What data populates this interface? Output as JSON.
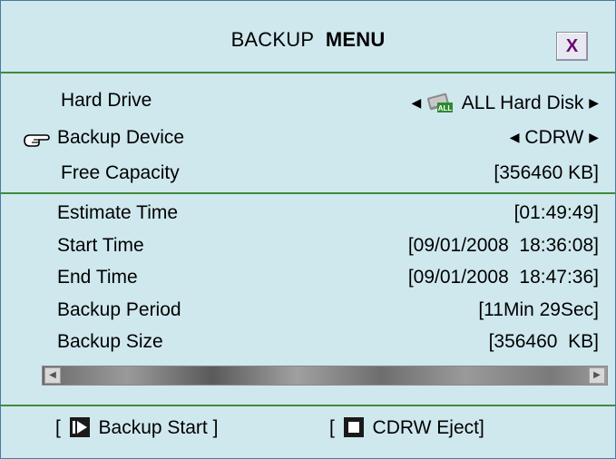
{
  "title": {
    "normal": "BACKUP",
    "bold": "MENU"
  },
  "close_button": {
    "label": "X"
  },
  "settings": {
    "hard_drive": {
      "label": "Hard Drive",
      "value": "ALL Hard Disk",
      "icon_label": "ALL"
    },
    "backup_device": {
      "label": "Backup Device",
      "value": "CDRW"
    },
    "free_capacity": {
      "label": "Free Capacity",
      "value": "[356460 KB]"
    }
  },
  "status": {
    "estimate_time": {
      "label": "Estimate Time",
      "value": "[01:49:49]"
    },
    "start_time": {
      "label": "Start Time",
      "value": "[09/01/2008  18:36:08]"
    },
    "end_time": {
      "label": "End Time",
      "value": "[09/01/2008  18:47:36]"
    },
    "backup_period": {
      "label": "Backup Period",
      "value": "[11Min 29Sec]"
    },
    "backup_size": {
      "label": "Backup Size",
      "value": "[356460  KB]"
    }
  },
  "footer": {
    "backup_start": {
      "open": "[",
      "label": "Backup Start",
      "close": "]"
    },
    "cdrw_eject": {
      "open": "[",
      "label": "CDRW Eject]"
    }
  },
  "colors": {
    "background": "#cfe8ee",
    "divider": "#3f8b3a",
    "close_x": "#6b0a74",
    "border": "#4a7aa0"
  }
}
